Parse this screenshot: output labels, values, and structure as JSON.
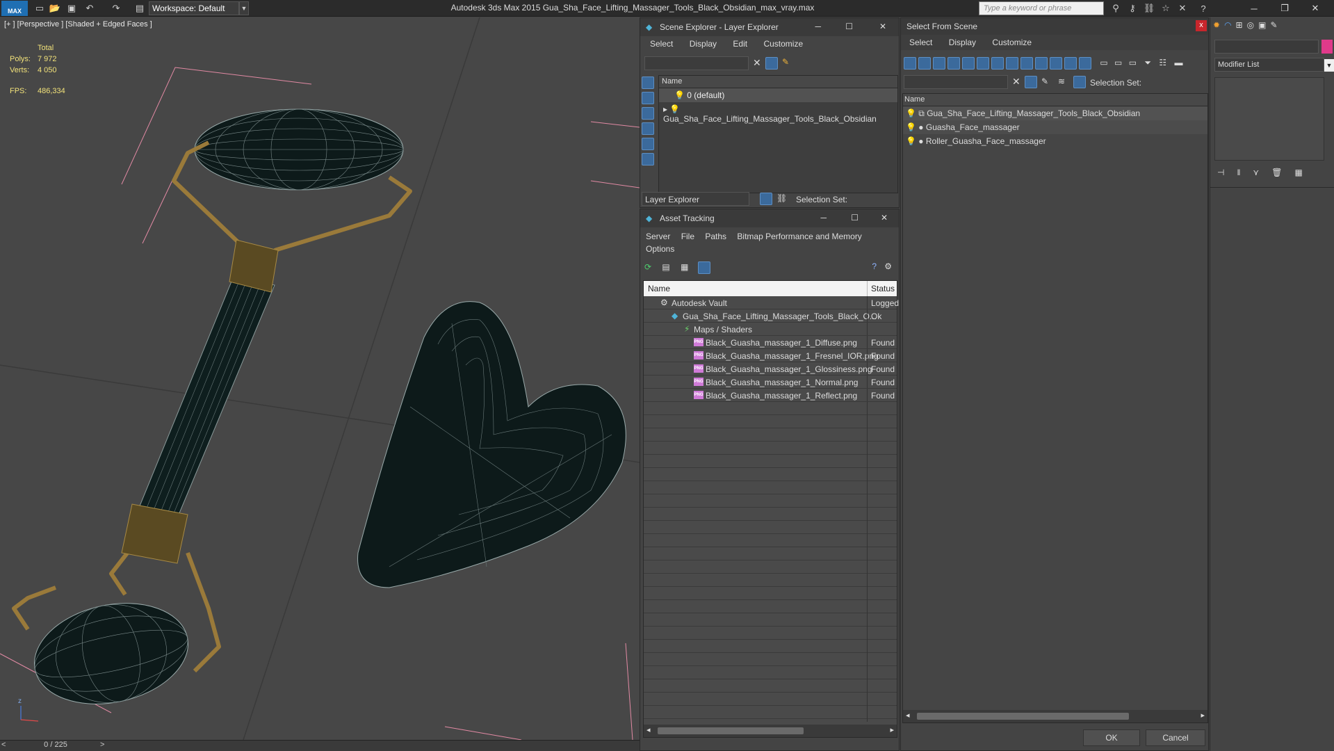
{
  "titlebar": {
    "logo": "MAX",
    "workspace": "Workspace: Default",
    "title": "Autodesk 3ds Max  2015     Gua_Sha_Face_Lifting_Massager_Tools_Black_Obsidian_max_vray.max",
    "search_placeholder": "Type a keyword or phrase"
  },
  "viewport": {
    "label": "[+ ] [Perspective ] [Shaded + Edged Faces ]",
    "stats": {
      "total_label": "Total",
      "polys_label": "Polys:",
      "polys_value": "7 972",
      "verts_label": "Verts:",
      "verts_value": "4 050",
      "fps_label": "FPS:",
      "fps_value": "486,334"
    },
    "axis_label": "z"
  },
  "timeline": {
    "frame": "0 / 225",
    "prev": "<",
    "next": ">"
  },
  "scene_explorer": {
    "title": "Scene Explorer - Layer Explorer",
    "menus": [
      "Select",
      "Display",
      "Edit",
      "Customize"
    ],
    "column_name": "Name",
    "rows": [
      {
        "label": "0 (default)"
      },
      {
        "label": "Gua_Sha_Face_Lifting_Massager_Tools_Black_Obsidian"
      }
    ],
    "footer_dropdown": "Layer Explorer",
    "selection_set_label": "Selection Set:"
  },
  "asset_tracking": {
    "title": "Asset Tracking",
    "menus": [
      "Server",
      "File",
      "Paths",
      "Bitmap Performance and Memory",
      "Options"
    ],
    "col_name": "Name",
    "col_status": "Status",
    "rows": [
      {
        "name": "Autodesk Vault",
        "status": "Logged"
      },
      {
        "name": "Gua_Sha_Face_Lifting_Massager_Tools_Black_O...",
        "status": "Ok"
      },
      {
        "name": "Maps / Shaders",
        "status": ""
      },
      {
        "name": "Black_Guasha_massager_1_Diffuse.png",
        "status": "Found"
      },
      {
        "name": "Black_Guasha_massager_1_Fresnel_IOR.png",
        "status": "Found"
      },
      {
        "name": "Black_Guasha_massager_1_Glossiness.png",
        "status": "Found"
      },
      {
        "name": "Black_Guasha_massager_1_Normal.png",
        "status": "Found"
      },
      {
        "name": "Black_Guasha_massager_1_Reflect.png",
        "status": "Found"
      }
    ],
    "png_badge": "PNG"
  },
  "select_from_scene": {
    "title": "Select From Scene",
    "close": "x",
    "menus": [
      "Select",
      "Display",
      "Customize"
    ],
    "selection_set_label": "Selection Set:",
    "column_name": "Name",
    "rows": [
      {
        "label": "Gua_Sha_Face_Lifting_Massager_Tools_Black_Obsidian"
      },
      {
        "label": "Guasha_Face_massager"
      },
      {
        "label": "Roller_Guasha_Face_massager"
      }
    ],
    "ok": "OK",
    "cancel": "Cancel"
  },
  "command_panel": {
    "modifier_list": "Modifier List"
  }
}
